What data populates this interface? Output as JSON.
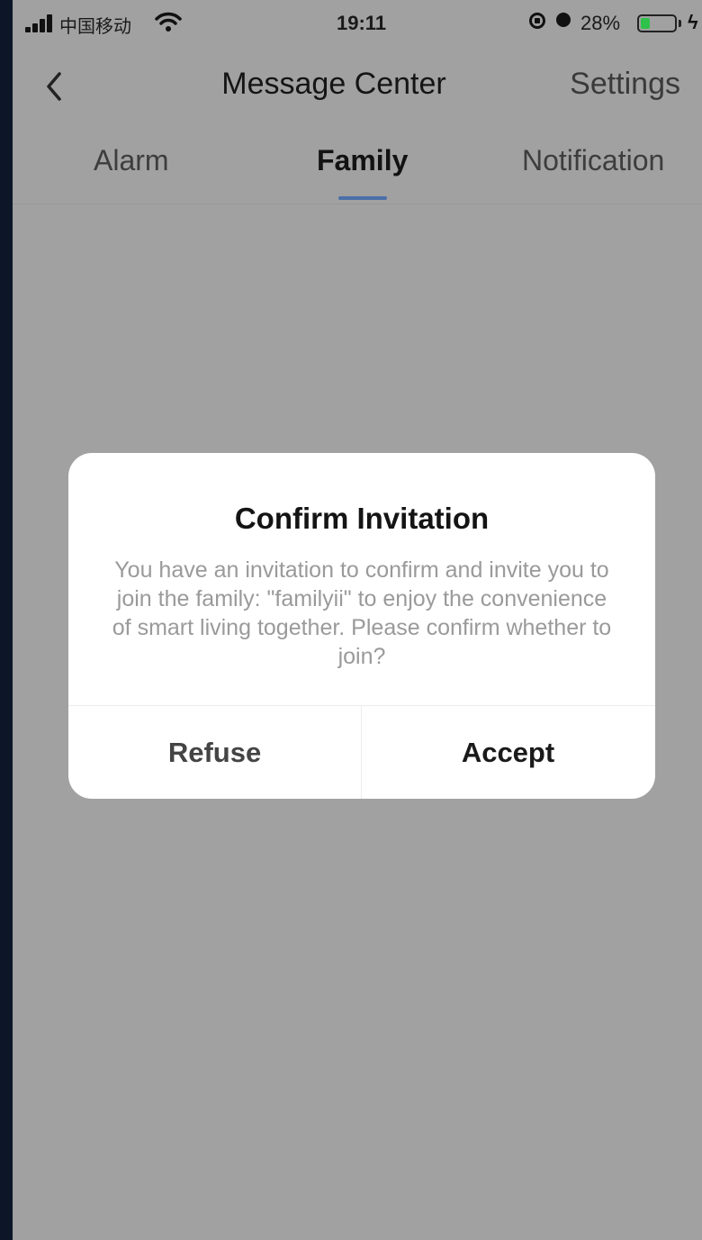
{
  "status_bar": {
    "carrier": "中国移动",
    "time": "19:11",
    "battery_percent": "28%",
    "battery_level": 0.28,
    "icons": [
      "signal-icon",
      "wifi-icon",
      "orientation-lock-icon",
      "alarm-icon",
      "battery-icon",
      "charging-icon"
    ]
  },
  "nav": {
    "title": "Message Center",
    "settings_label": "Settings",
    "back_icon": "chevron-left-icon"
  },
  "tabs": [
    {
      "label": "Alarm",
      "active": false
    },
    {
      "label": "Family",
      "active": true
    },
    {
      "label": "Notification",
      "active": false
    }
  ],
  "dialog": {
    "title": "Confirm Invitation",
    "message": "You have an invitation to confirm and invite you to join the family: \"familyii\" to enjoy the convenience of smart living together. Please confirm whether to join?",
    "refuse_label": "Refuse",
    "accept_label": "Accept"
  },
  "colors": {
    "overlay": "#a1a1a1",
    "tab_underline": "#4c6fa8",
    "battery": "#2fc24a",
    "frame": "#0c1628"
  }
}
